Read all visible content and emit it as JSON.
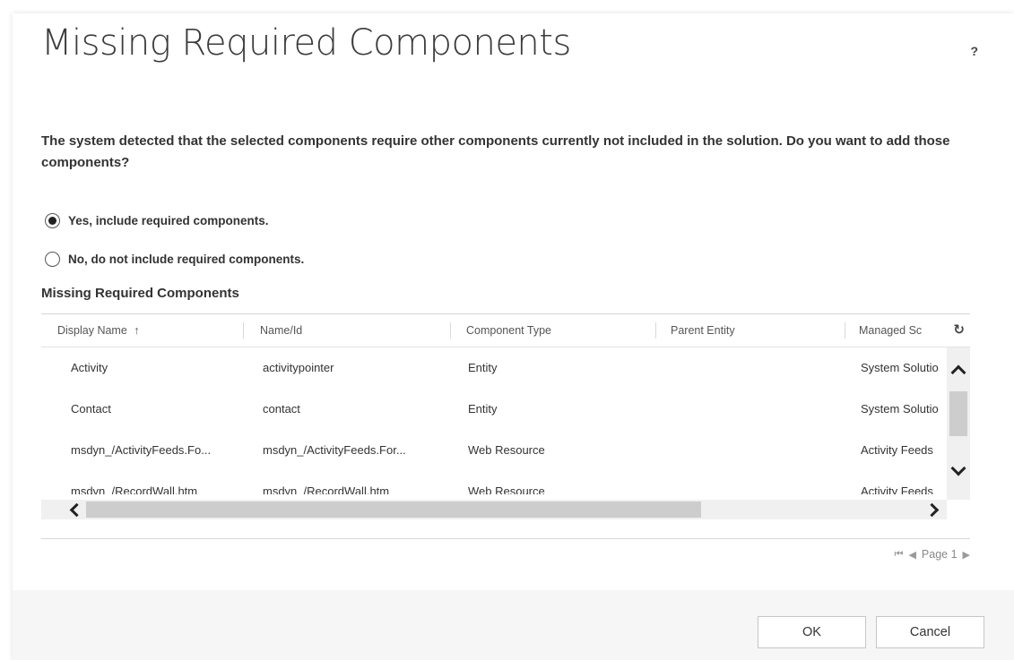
{
  "dialog": {
    "title": "Missing Required Components",
    "help": "?",
    "message": "The system detected that the selected components require other components currently not included in the solution. Do you want to add those components?"
  },
  "options": [
    {
      "label": "Yes, include required components.",
      "checked": true
    },
    {
      "label": "No, do not include required components.",
      "checked": false
    }
  ],
  "grid": {
    "section_title": "Missing Required Components",
    "columns": [
      "Display Name",
      "Name/Id",
      "Component Type",
      "Parent Entity",
      "Managed Sc"
    ],
    "sort_indicator": "↑",
    "refresh_icon": "refresh-icon",
    "rows": [
      [
        "Activity",
        "activitypointer",
        "Entity",
        "",
        "System Solutio"
      ],
      [
        "Contact",
        "contact",
        "Entity",
        "",
        "System Solutio"
      ],
      [
        "msdyn_/ActivityFeeds.Fo...",
        "msdyn_/ActivityFeeds.For...",
        "Web Resource",
        "",
        "Activity Feeds"
      ],
      [
        "msdyn_/RecordWall.htm",
        "msdyn_/RecordWall.htm",
        "Web Resource",
        "",
        "Activity Feeds"
      ]
    ]
  },
  "pager": {
    "label": "Page 1"
  },
  "buttons": {
    "ok": "OK",
    "cancel": "Cancel"
  },
  "colors": {
    "footer_bg": "#f6f6f6",
    "scroll_thumb": "#cdcdcd"
  }
}
